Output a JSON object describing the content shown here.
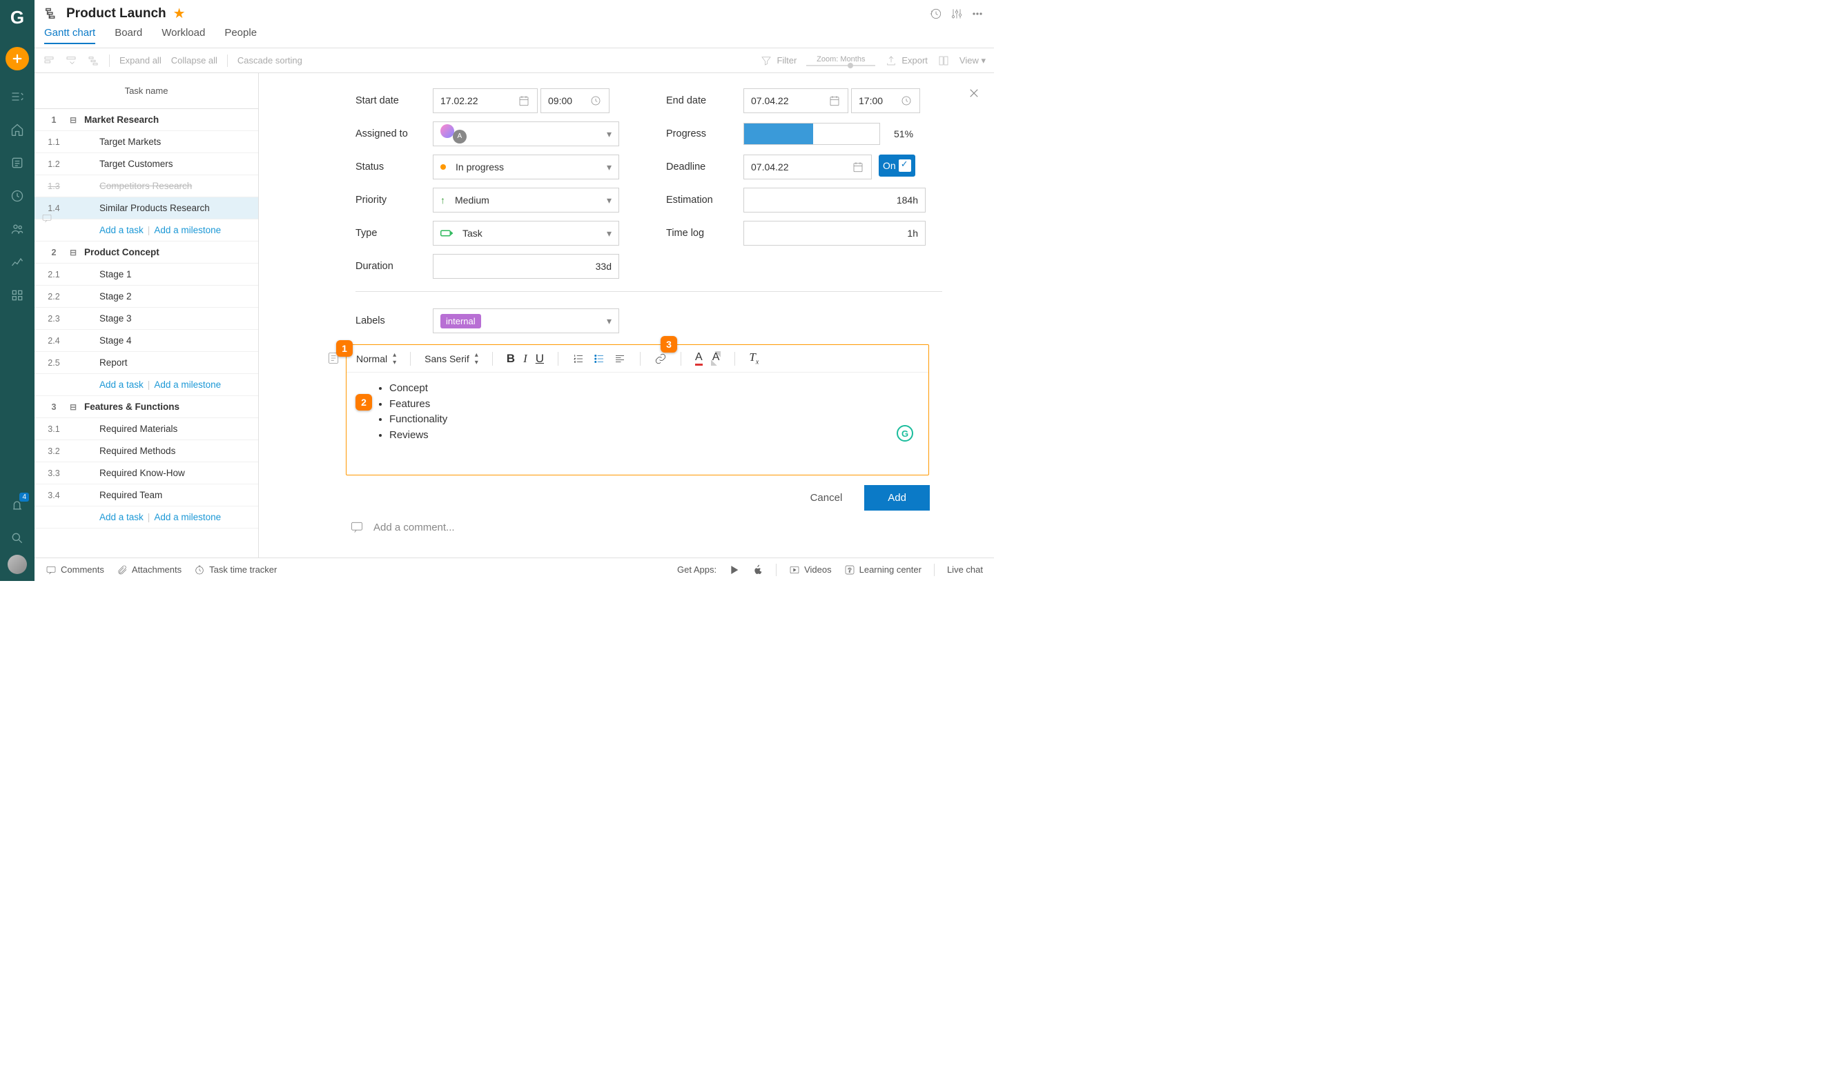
{
  "project": {
    "title": "Product Launch"
  },
  "tabs": {
    "gantt": "Gantt chart",
    "board": "Board",
    "workload": "Workload",
    "people": "People"
  },
  "toolbar": {
    "expand": "Expand all",
    "collapse": "Collapse all",
    "cascade": "Cascade sorting",
    "filter": "Filter",
    "zoom_label": "Zoom:",
    "zoom_value": "Months",
    "export": "Export",
    "view": "View"
  },
  "tasklist": {
    "header": "Task name",
    "add_task": "Add a task",
    "add_milestone": "Add a milestone",
    "groups": [
      {
        "num": "1",
        "name": "Market Research",
        "children": [
          {
            "num": "1.1",
            "name": "Target Markets"
          },
          {
            "num": "1.2",
            "name": "Target Customers"
          },
          {
            "num": "1.3",
            "name": "Competitors Research",
            "completed": true,
            "has_icon": true
          },
          {
            "num": "1.4",
            "name": "Similar Products Research",
            "selected": true
          }
        ]
      },
      {
        "num": "2",
        "name": "Product Concept",
        "children": [
          {
            "num": "2.1",
            "name": "Stage 1"
          },
          {
            "num": "2.2",
            "name": "Stage 2"
          },
          {
            "num": "2.3",
            "name": "Stage 3"
          },
          {
            "num": "2.4",
            "name": "Stage 4"
          },
          {
            "num": "2.5",
            "name": "Report"
          }
        ]
      },
      {
        "num": "3",
        "name": "Features & Functions",
        "children": [
          {
            "num": "3.1",
            "name": "Required Materials"
          },
          {
            "num": "3.2",
            "name": "Required Methods"
          },
          {
            "num": "3.3",
            "name": "Required Know-How"
          },
          {
            "num": "3.4",
            "name": "Required Team"
          }
        ]
      }
    ]
  },
  "detail": {
    "start_date_label": "Start date",
    "start_date": "17.02.22",
    "start_time": "09:00",
    "end_date_label": "End date",
    "end_date": "07.04.22",
    "end_time": "17:00",
    "assigned_label": "Assigned to",
    "progress_label": "Progress",
    "progress_pct": "51%",
    "progress_fill": 51,
    "status_label": "Status",
    "status_value": "In progress",
    "status_color": "#ff9800",
    "deadline_label": "Deadline",
    "deadline_date": "07.04.22",
    "deadline_on": "On",
    "priority_label": "Priority",
    "priority_value": "Medium",
    "estimation_label": "Estimation",
    "estimation_value": "184h",
    "type_label": "Type",
    "type_value": "Task",
    "timelog_label": "Time log",
    "timelog_value": "1h",
    "duration_label": "Duration",
    "duration_value": "33d",
    "labels_label": "Labels",
    "label_chip": "internal"
  },
  "editor": {
    "format": "Normal",
    "font": "Sans Serif",
    "bullets": [
      "Concept",
      "Features",
      "Functionality",
      "Reviews"
    ],
    "cancel": "Cancel",
    "add": "Add"
  },
  "comment": {
    "placeholder": "Add a comment..."
  },
  "footer": {
    "comments": "Comments",
    "attachments": "Attachments",
    "time_tracker": "Task time tracker",
    "get_apps": "Get Apps:",
    "videos": "Videos",
    "learning": "Learning center",
    "live_chat": "Live chat"
  },
  "anno": {
    "a1": "1",
    "a2": "2",
    "a3": "3"
  },
  "sidebar": {
    "notif_count": "4"
  }
}
